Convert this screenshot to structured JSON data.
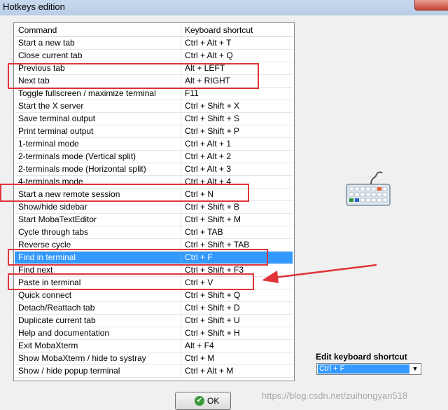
{
  "window": {
    "title": "Hotkeys edition"
  },
  "table": {
    "headers": [
      "Command",
      "Keyboard shortcut"
    ],
    "rows": [
      [
        "Start a new tab",
        "Ctrl + Alt + T"
      ],
      [
        "Close current tab",
        "Ctrl + Alt + Q"
      ],
      [
        "Previous tab",
        "Alt + LEFT"
      ],
      [
        "Next tab",
        "Alt + RIGHT"
      ],
      [
        "Toggle fullscreen / maximize terminal",
        "F11"
      ],
      [
        "Start the X server",
        "Ctrl + Shift + X"
      ],
      [
        "Save terminal output",
        "Ctrl + Shift + S"
      ],
      [
        "Print terminal output",
        "Ctrl + Shift + P"
      ],
      [
        "1-terminal mode",
        "Ctrl + Alt + 1"
      ],
      [
        "2-terminals mode (Vertical split)",
        "Ctrl + Alt + 2"
      ],
      [
        "2-terminals mode (Horizontal split)",
        "Ctrl + Alt + 3"
      ],
      [
        "4-terminals mode",
        "Ctrl + Alt + 4"
      ],
      [
        "Start a new remote session",
        "Ctrl + N"
      ],
      [
        "Show/hide sidebar",
        "Ctrl + Shift + B"
      ],
      [
        "Start MobaTextEditor",
        "Ctrl + Shift + M"
      ],
      [
        "Cycle through tabs",
        "Ctrl + TAB"
      ],
      [
        "Reverse cycle",
        "Ctrl + Shift + TAB"
      ],
      [
        "Find in terminal",
        "Ctrl + F"
      ],
      [
        "Find next",
        "Ctrl + Shift + F3"
      ],
      [
        "Paste in terminal",
        "Ctrl + V"
      ],
      [
        "Quick connect",
        "Ctrl + Shift + Q"
      ],
      [
        "Detach/Reattach tab",
        "Ctrl + Shift + D"
      ],
      [
        "Duplicate current tab",
        "Ctrl + Shift + U"
      ],
      [
        "Help and documentation",
        "Ctrl + Shift + H"
      ],
      [
        "Exit MobaXterm",
        "Alt + F4"
      ],
      [
        "Show MobaXterm / hide to systray",
        "Ctrl + M"
      ],
      [
        "Show / hide popup terminal",
        "Ctrl + Alt + M"
      ]
    ],
    "selected_index": 17
  },
  "edit_shortcut": {
    "label": "Edit keyboard shortcut",
    "value": "Ctrl + F"
  },
  "ok_button": {
    "label": "OK"
  },
  "watermark": "https://blog.csdn.net/zuihongyan518",
  "colors": {
    "selection": "#3399ff",
    "annotation": "#e0343a"
  }
}
